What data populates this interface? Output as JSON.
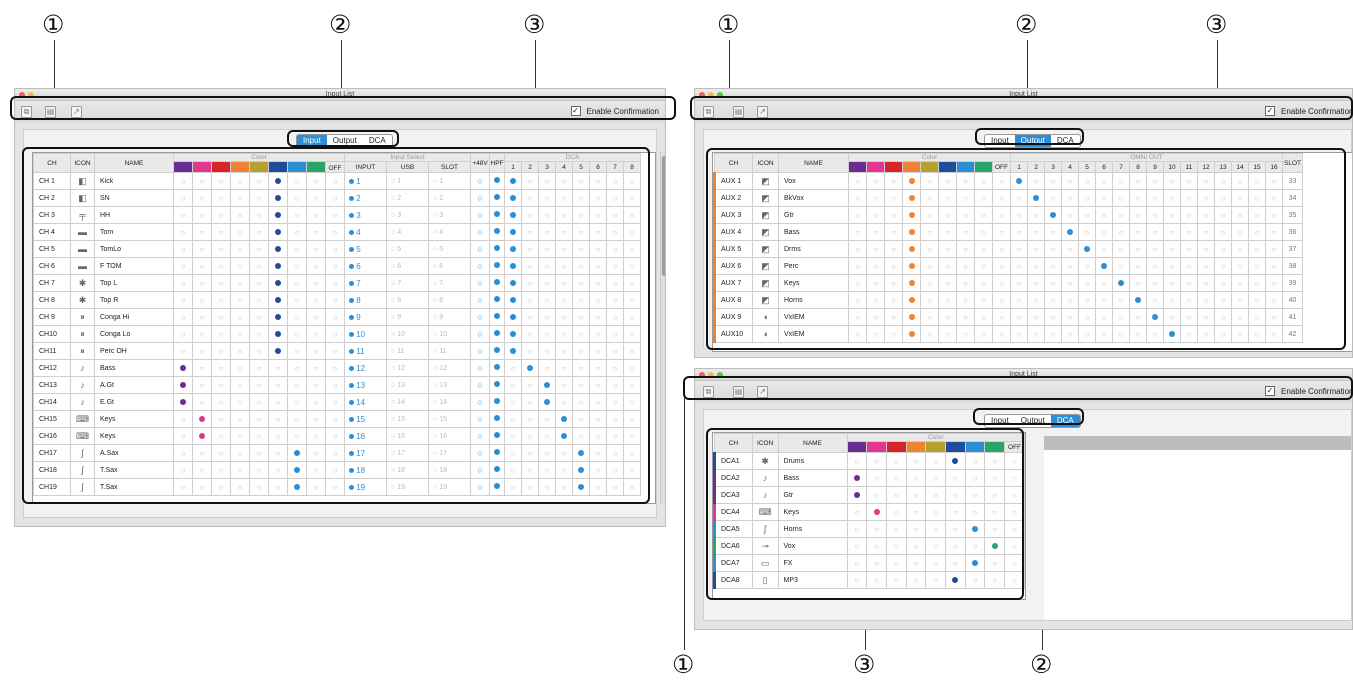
{
  "callouts": {
    "one": "①",
    "two": "②",
    "three": "③"
  },
  "window_title": "Input List",
  "toolbar": {
    "enable_confirmation": "Enable Confirmation",
    "check_mark": "✓"
  },
  "tabs": {
    "input": "Input",
    "output": "Output",
    "dca": "DCA"
  },
  "headers": {
    "ch": "CH",
    "icon": "ICON",
    "name": "NAME",
    "color": "Color",
    "off": "OFF",
    "input_select": "Input Select",
    "input": "INPUT",
    "usb": "USB",
    "slot": "SLOT",
    "v48": "+48V",
    "hpf": "HPF",
    "dca": "DCA",
    "omni_out": "OMNI OUT"
  },
  "colors": {
    "palette": [
      "#6a2d91",
      "#e2368f",
      "#d8232a",
      "#f08331",
      "#b5a22e",
      "#1f4c9c",
      "#2b8fd6",
      "#2aa56a"
    ],
    "accent": "#2b8fd6"
  },
  "input_rows": [
    {
      "ch": "CH 1",
      "icon": "snare-icon",
      "name": "Kick",
      "color": 5,
      "input": "1",
      "usb": "1",
      "slot": "1",
      "hpf": true,
      "dca": 1
    },
    {
      "ch": "CH 2",
      "icon": "snare-icon",
      "name": "SN",
      "color": 5,
      "input": "2",
      "usb": "2",
      "slot": "2",
      "hpf": true,
      "dca": 1
    },
    {
      "ch": "CH 3",
      "icon": "hihat-icon",
      "name": "HH",
      "color": 5,
      "input": "3",
      "usb": "3",
      "slot": "3",
      "hpf": true,
      "dca": 1
    },
    {
      "ch": "CH 4",
      "icon": "tom-icon",
      "name": "Tom",
      "color": 5,
      "input": "4",
      "usb": "4",
      "slot": "4",
      "hpf": true,
      "dca": 1
    },
    {
      "ch": "CH 5",
      "icon": "tom-icon",
      "name": "TomLo",
      "color": 5,
      "input": "5",
      "usb": "5",
      "slot": "5",
      "hpf": true,
      "dca": 1
    },
    {
      "ch": "CH 6",
      "icon": "tom-icon",
      "name": "F TOM",
      "color": 5,
      "input": "6",
      "usb": "6",
      "slot": "6",
      "hpf": true,
      "dca": 1
    },
    {
      "ch": "CH 7",
      "icon": "cymbal-icon",
      "name": "Top L",
      "color": 5,
      "input": "7",
      "usb": "7",
      "slot": "7",
      "hpf": true,
      "dca": 1
    },
    {
      "ch": "CH 8",
      "icon": "cymbal-icon",
      "name": "Top R",
      "color": 5,
      "input": "8",
      "usb": "8",
      "slot": "8",
      "hpf": true,
      "dca": 1
    },
    {
      "ch": "CH 9",
      "icon": "conga-icon",
      "name": "Conga Hi",
      "color": 5,
      "input": "9",
      "usb": "9",
      "slot": "9",
      "hpf": true,
      "dca": 1
    },
    {
      "ch": "CH10",
      "icon": "conga-icon",
      "name": "Conga Lo",
      "color": 5,
      "input": "10",
      "usb": "10",
      "slot": "10",
      "hpf": true,
      "dca": 1
    },
    {
      "ch": "CH11",
      "icon": "conga-icon",
      "name": "Perc OH",
      "color": 5,
      "input": "11",
      "usb": "11",
      "slot": "11",
      "hpf": true,
      "dca": 1
    },
    {
      "ch": "CH12",
      "icon": "bass-guitar-icon",
      "name": "Bass",
      "color": 0,
      "input": "12",
      "usb": "12",
      "slot": "12",
      "hpf": true,
      "dca": 2
    },
    {
      "ch": "CH13",
      "icon": "guitar-icon",
      "name": "A.Gt",
      "color": 0,
      "input": "13",
      "usb": "13",
      "slot": "13",
      "hpf": true,
      "dca": 3
    },
    {
      "ch": "CH14",
      "icon": "guitar-icon",
      "name": "E.Gt",
      "color": 0,
      "input": "14",
      "usb": "14",
      "slot": "14",
      "hpf": true,
      "dca": 3
    },
    {
      "ch": "CH15",
      "icon": "keyboard-icon",
      "name": "Keys",
      "color": 1,
      "input": "15",
      "usb": "15",
      "slot": "15",
      "hpf": true,
      "dca": 4
    },
    {
      "ch": "CH16",
      "icon": "keyboard-icon",
      "name": "Keys",
      "color": 1,
      "input": "16",
      "usb": "16",
      "slot": "16",
      "hpf": true,
      "dca": 4
    },
    {
      "ch": "CH17",
      "icon": "sax-icon",
      "name": "A.Sax",
      "color": 6,
      "input": "17",
      "usb": "17",
      "slot": "17",
      "hpf": true,
      "dca": 5
    },
    {
      "ch": "CH18",
      "icon": "sax-icon",
      "name": "T.Sax",
      "color": 6,
      "input": "18",
      "usb": "18",
      "slot": "18",
      "hpf": true,
      "dca": 5
    },
    {
      "ch": "CH19",
      "icon": "sax-icon",
      "name": "T.Sax",
      "color": 6,
      "input": "19",
      "usb": "19",
      "slot": "19",
      "hpf": true,
      "dca": 5
    }
  ],
  "output_rows": [
    {
      "ch": "AUX 1",
      "icon": "monitor-icon",
      "name": "Vox",
      "color": 3,
      "omni": 1,
      "slot": "33"
    },
    {
      "ch": "AUX 2",
      "icon": "monitor-icon",
      "name": "BkVox",
      "color": 3,
      "omni": 2,
      "slot": "34"
    },
    {
      "ch": "AUX 3",
      "icon": "monitor-icon",
      "name": "Gtr",
      "color": 3,
      "omni": 3,
      "slot": "35"
    },
    {
      "ch": "AUX 4",
      "icon": "monitor-icon",
      "name": "Bass",
      "color": 3,
      "omni": 4,
      "slot": "36"
    },
    {
      "ch": "AUX 5",
      "icon": "monitor-icon",
      "name": "Drms",
      "color": 3,
      "omni": 5,
      "slot": "37"
    },
    {
      "ch": "AUX 6",
      "icon": "monitor-icon",
      "name": "Perc",
      "color": 3,
      "omni": 6,
      "slot": "38"
    },
    {
      "ch": "AUX 7",
      "icon": "monitor-icon",
      "name": "Keys",
      "color": 3,
      "omni": 7,
      "slot": "39"
    },
    {
      "ch": "AUX 8",
      "icon": "monitor-icon",
      "name": "Horns",
      "color": 3,
      "omni": 8,
      "slot": "40"
    },
    {
      "ch": "AUX 9",
      "icon": "iem-icon",
      "name": "VxIEM",
      "color": 3,
      "omni": 9,
      "slot": "41"
    },
    {
      "ch": "AUX10",
      "icon": "iem-icon",
      "name": "VxIEM",
      "color": 3,
      "omni": 10,
      "slot": "42"
    }
  ],
  "dca_rows": [
    {
      "ch": "DCA1",
      "icon": "drums-icon",
      "name": "Drums",
      "color": 5
    },
    {
      "ch": "DCA2",
      "icon": "guitar-icon",
      "name": "Bass",
      "color": 0
    },
    {
      "ch": "DCA3",
      "icon": "guitar-icon",
      "name": "Gtr",
      "color": 0
    },
    {
      "ch": "DCA4",
      "icon": "keyboard-icon",
      "name": "Keys",
      "color": 1
    },
    {
      "ch": "DCA5",
      "icon": "sax-icon",
      "name": "Horns",
      "color": 6
    },
    {
      "ch": "DCA6",
      "icon": "mic-icon",
      "name": "Vox",
      "color": 7
    },
    {
      "ch": "DCA7",
      "icon": "effects-icon",
      "name": "FX",
      "color": 6
    },
    {
      "ch": "DCA8",
      "icon": "player-icon",
      "name": "MP3",
      "color": 5
    }
  ]
}
